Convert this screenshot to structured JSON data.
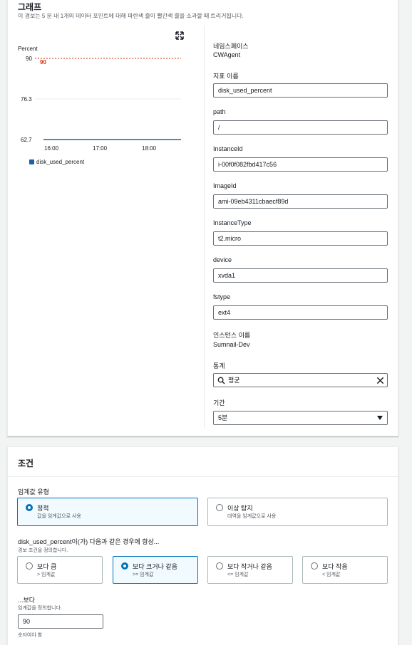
{
  "graph": {
    "title": "그래프",
    "subtitle": "이 경보는 5 분 내 1개의 데이터 포인트에 대해 파란색 줄이 빨간색 줄을 소과할 때 트리거됩니다.",
    "expand_icon": "expand-icon"
  },
  "chart_data": {
    "type": "line",
    "ylabel": "Percent",
    "y_ticks": [
      "90",
      "76.3",
      "62.7"
    ],
    "x_ticks": [
      "16:00",
      "17:00",
      "18:00"
    ],
    "ylim": [
      62.7,
      90
    ],
    "threshold": {
      "value": 90,
      "label": "90",
      "color": "#d13212"
    },
    "series": [
      {
        "name": "disk_used_percent",
        "color": "#1f5fa6",
        "values": [
          62.7,
          62.7,
          62.7,
          62.7,
          62.7,
          62.7,
          62.7
        ]
      }
    ],
    "legend": "bottom-left",
    "grid": true
  },
  "fields": {
    "namespace_label": "네임스페이스",
    "namespace_value": "CWAgent",
    "metric_name_label": "지표 이름",
    "metric_name_value": "disk_used_percent",
    "path_label": "path",
    "path_value": "/",
    "instanceid_label": "InstanceId",
    "instanceid_value": "i-00f0f082fbd417c56",
    "imageid_label": "ImageId",
    "imageid_value": "ami-09eb4311cbaecf89d",
    "instancetype_label": "InstanceType",
    "instancetype_value": "t2.micro",
    "device_label": "device",
    "device_value": "xvda1",
    "fstype_label": "fstype",
    "fstype_value": "ext4",
    "instance_name_label": "인스턴스 이름",
    "instance_name_value": "Sumnail-Dev",
    "statistic_label": "통계",
    "statistic_value": "평균",
    "period_label": "기간",
    "period_value": "5분"
  },
  "conditions": {
    "title": "조건",
    "threshold_type_label": "임계값 유형",
    "static_title": "정적",
    "static_sub": "값을 임계값으로 사용",
    "anomaly_title": "이상 탐지",
    "anomaly_sub": "대역을 임계값으로 사용",
    "whenever_label": "disk_used_percent이(가) 다음과 같은 경우에 항상...",
    "whenever_sub": "경보 조건을 정의합니다.",
    "greater_title": "보다 큼",
    "greater_sub": "> 임계값",
    "gte_title": "보다 크거나 같음",
    "gte_sub": ">= 임계값",
    "lte_title": "보다 작거나 같음",
    "lte_sub": "<= 임계값",
    "lower_title": "보다 작음",
    "lower_sub": "< 임계값",
    "than_label": "...보다",
    "than_sub": "임계값을 정의합니다.",
    "than_value": "90",
    "than_hint": "숫자여야 함"
  }
}
